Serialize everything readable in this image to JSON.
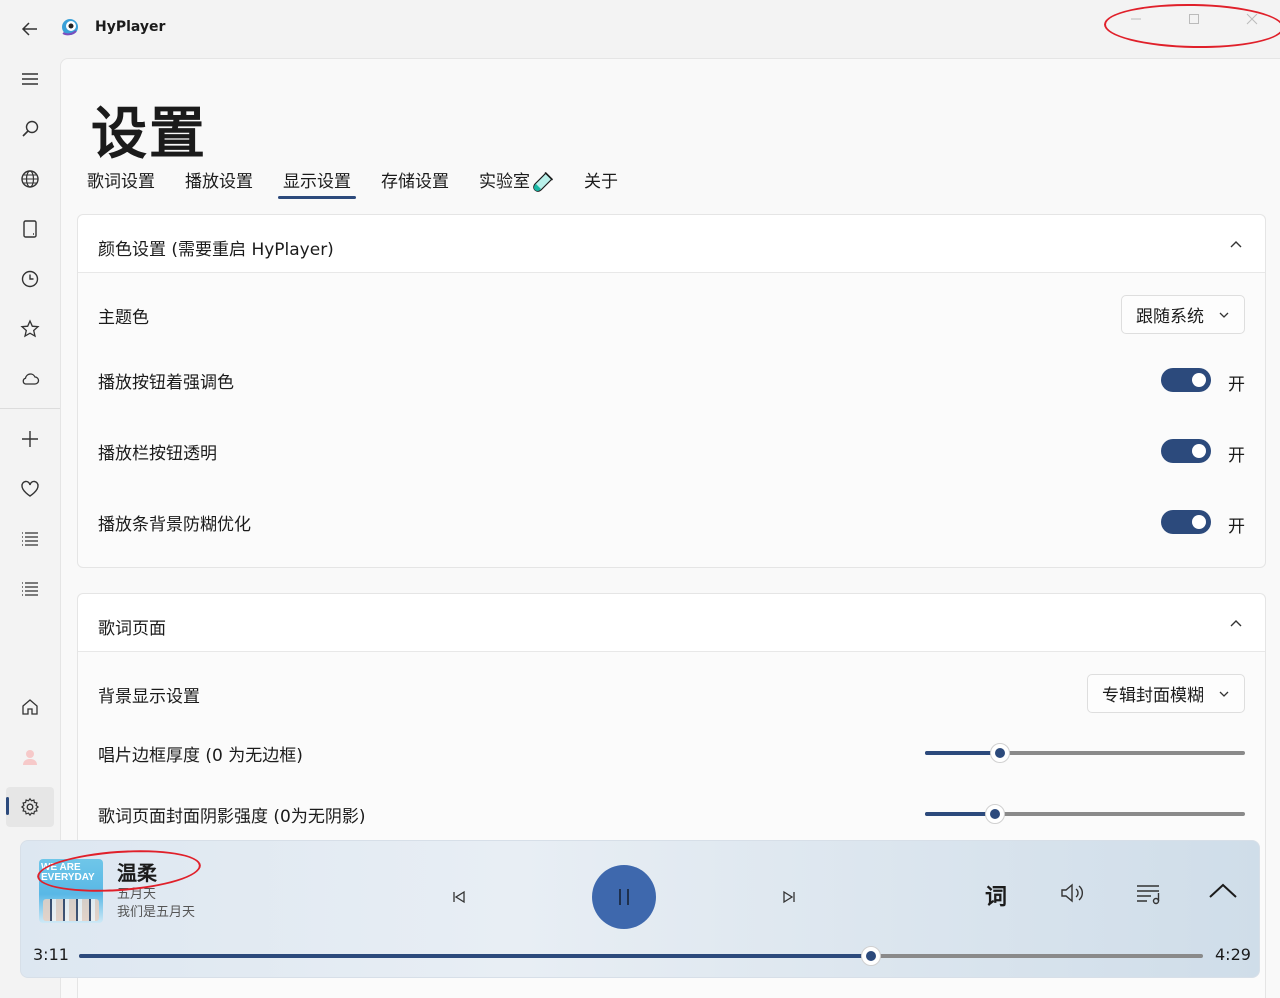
{
  "app": {
    "title": "HyPlayer"
  },
  "page": {
    "title": "设置"
  },
  "tabs": [
    {
      "label": "歌词设置",
      "active": false
    },
    {
      "label": "播放设置",
      "active": false
    },
    {
      "label": "显示设置",
      "active": true
    },
    {
      "label": "存储设置",
      "active": false
    },
    {
      "label": "实验室",
      "active": false,
      "icon": "flask-icon"
    },
    {
      "label": "关于",
      "active": false
    }
  ],
  "nav": [
    "menu-icon",
    "search-icon",
    "globe-icon",
    "tablet-icon",
    "clock-icon",
    "star-icon",
    "cloud-icon",
    "plus-icon",
    "heart-icon",
    "list-icon",
    "list-icon",
    "home-icon",
    "user-icon",
    "gear-icon"
  ],
  "sections": {
    "color": {
      "title": "颜色设置 (需要重启 HyPlayer)",
      "theme_label": "主题色",
      "theme_value": "跟随系统",
      "toggles": [
        {
          "label": "播放按钮着强调色",
          "state": "开",
          "on": true
        },
        {
          "label": "播放栏按钮透明",
          "state": "开",
          "on": true
        },
        {
          "label": "播放条背景防糊优化",
          "state": "开",
          "on": true
        }
      ]
    },
    "lyric_page": {
      "title": "歌词页面",
      "bg_label": "背景显示设置",
      "bg_value": "专辑封面模糊",
      "sliders": [
        {
          "label": "唱片边框厚度 (0 为无边框)",
          "fraction": 0.235
        },
        {
          "label": "歌词页面封面阴影强度 (0为无阴影)",
          "fraction": 0.219
        }
      ]
    }
  },
  "player": {
    "song_title": "温柔",
    "artist": "五月天",
    "album": "我们是五月天",
    "album_art_text": "WE ARE EVERYDAY",
    "lyric_button": "词",
    "current_time": "3:11",
    "total_time": "4:29",
    "progress_fraction": 0.705
  },
  "colors": {
    "accent": "#2c4a7c",
    "play_button": "#3e68ad",
    "annotation": "#e0202a"
  }
}
